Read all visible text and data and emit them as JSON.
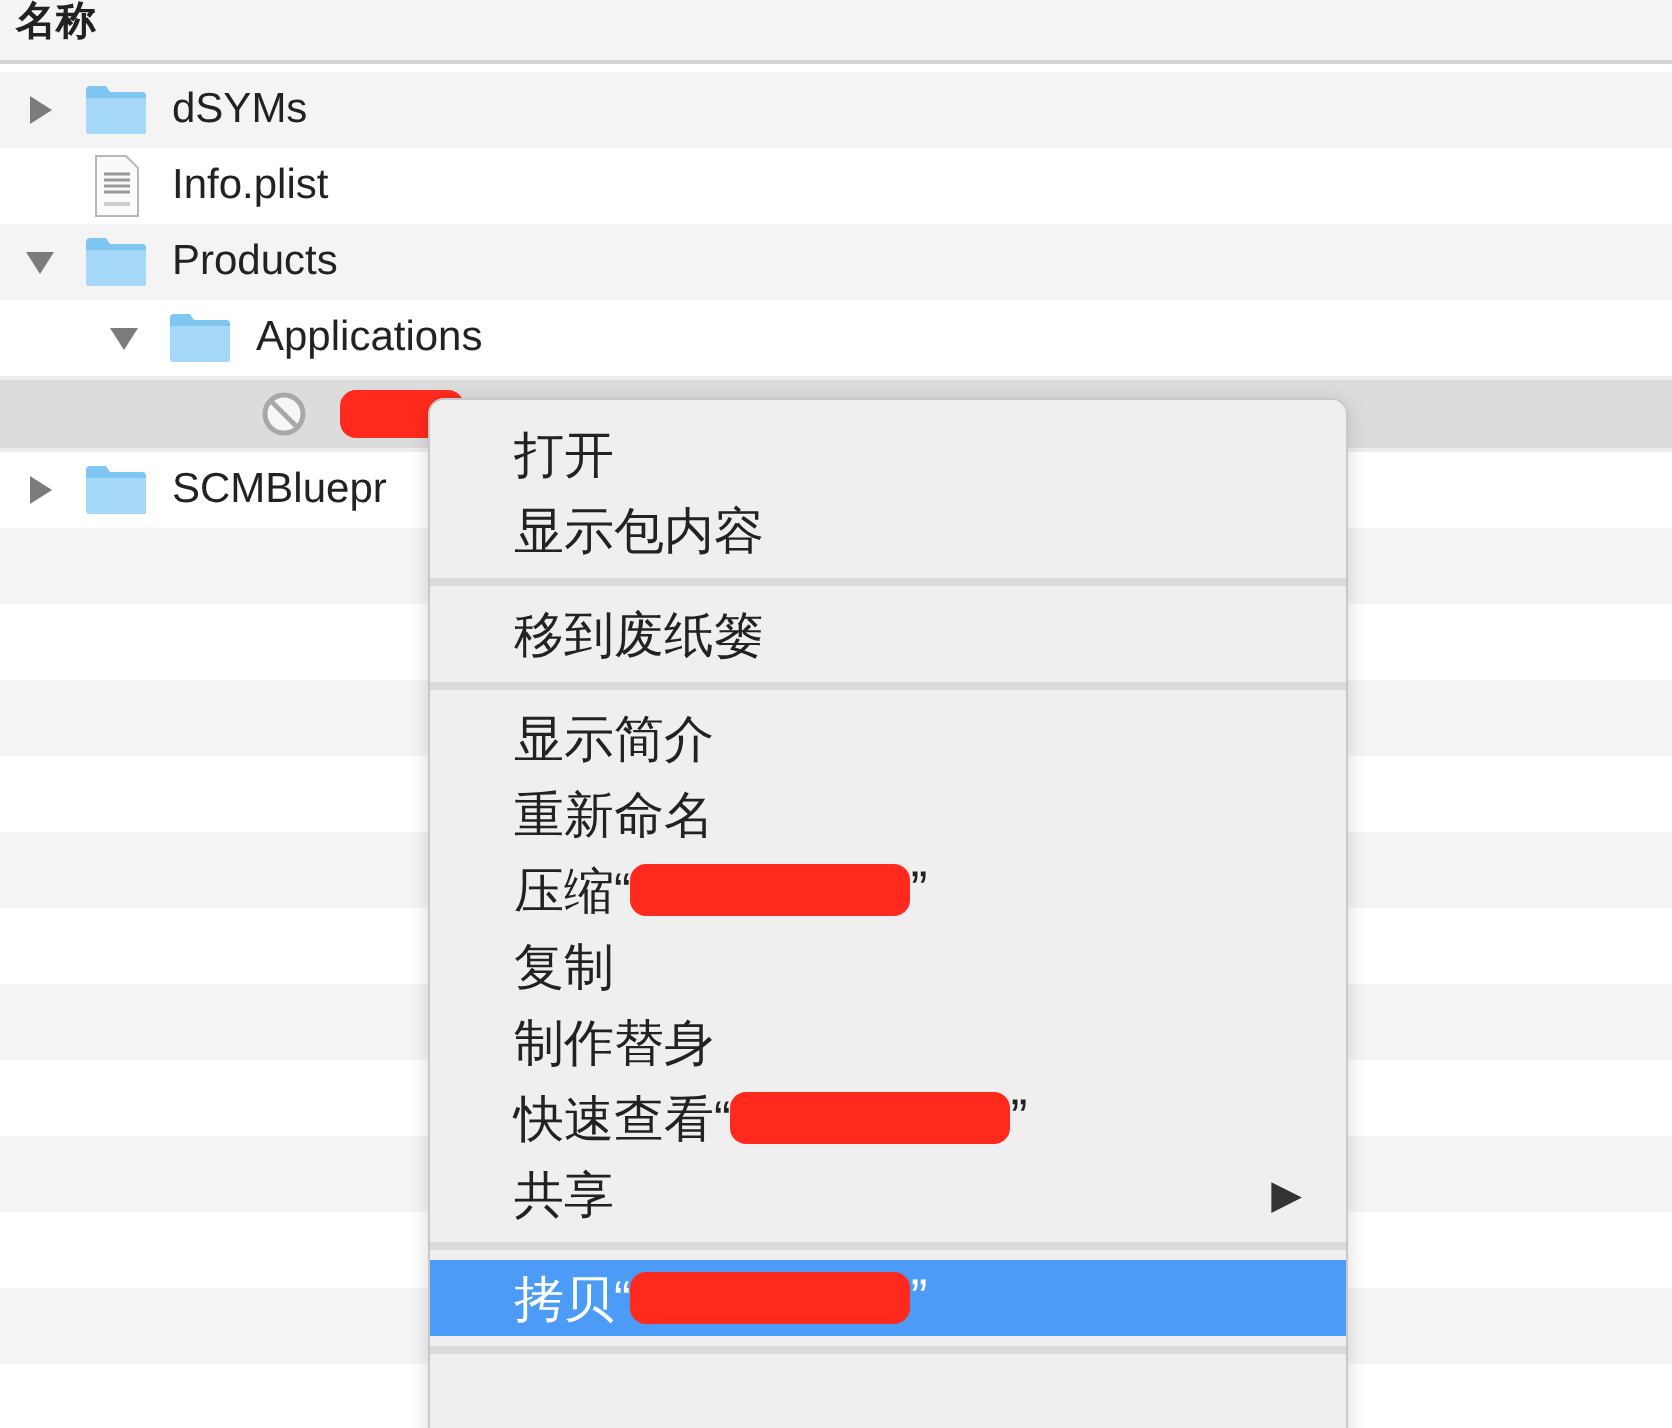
{
  "header": {
    "label": "名称"
  },
  "files": [
    {
      "kind": "folder",
      "name": "dSYMs",
      "expanded": false
    },
    {
      "kind": "plist",
      "name": "Info.plist"
    },
    {
      "kind": "folder",
      "name": "Products",
      "expanded": true,
      "children": [
        {
          "kind": "folder",
          "name": "Applications",
          "expanded": true,
          "children": [
            {
              "kind": "app",
              "redacted": true,
              "selected": true
            }
          ]
        }
      ]
    },
    {
      "kind": "folder",
      "name": "SCMBluepr",
      "expanded": false
    }
  ],
  "menu": [
    {
      "kind": "item",
      "label": "打开",
      "selected": false
    },
    {
      "kind": "item",
      "label": "显示包内容",
      "selected": false
    },
    {
      "kind": "separator"
    },
    {
      "kind": "item",
      "label": "移到废纸篓",
      "selected": false
    },
    {
      "kind": "separator"
    },
    {
      "kind": "item",
      "label": "显示简介",
      "selected": false
    },
    {
      "kind": "item",
      "label": "重新命名",
      "selected": false
    },
    {
      "kind": "item",
      "label": "压缩“",
      "redacted": true,
      "suffix": "”",
      "selected": false
    },
    {
      "kind": "item",
      "label": "复制",
      "selected": false
    },
    {
      "kind": "item",
      "label": "制作替身",
      "selected": false
    },
    {
      "kind": "item",
      "label": "快速查看“",
      "redacted": true,
      "suffix": "”",
      "selected": false
    },
    {
      "kind": "item",
      "label": "共享",
      "arrow": "▶",
      "selected": false
    },
    {
      "kind": "separator"
    },
    {
      "kind": "item",
      "label": "拷贝“",
      "redacted": true,
      "suffix": "”",
      "selected": true
    },
    {
      "kind": "separator"
    }
  ]
}
